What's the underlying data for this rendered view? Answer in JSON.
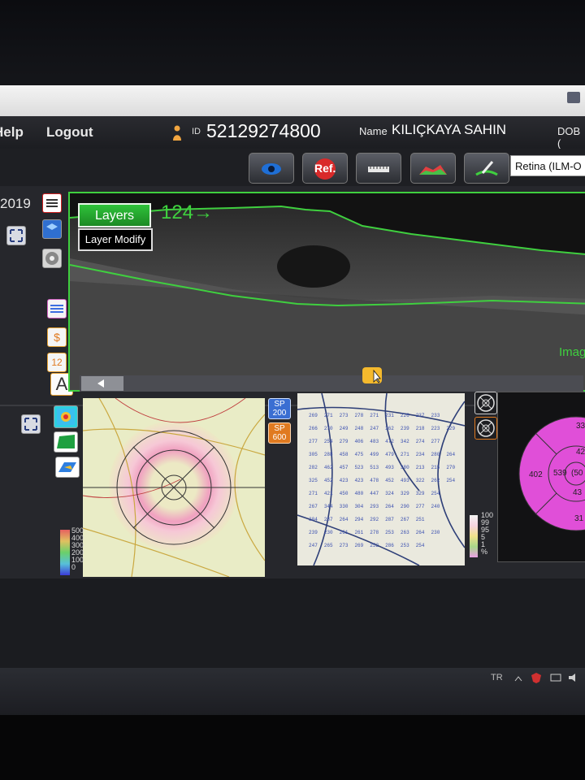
{
  "menu": {
    "help": "Help",
    "logout": "Logout"
  },
  "patient": {
    "id_label": "ID",
    "id_value": "52129274800",
    "name_label": "Name",
    "name_value": "KILIÇKAYA SAHIN",
    "dob_label": "DOB ("
  },
  "toolbar": {
    "ref_label": "Ref.",
    "retina_select": "Retina (ILM-O"
  },
  "sidebar": {
    "date_fragment": "2019",
    "btn_s": "$",
    "btn_12": "12",
    "btn_a": "A"
  },
  "oct": {
    "layers_label": "Layers",
    "layer_modify_label": "Layer Modify",
    "slice_label": "124→",
    "image_label": "Imag"
  },
  "sp_buttons": [
    {
      "label": "SP 200"
    },
    {
      "label": "SP 600"
    }
  ],
  "thickness_legend": {
    "ticks": [
      "500",
      "400",
      "300",
      "200",
      "100",
      "0"
    ]
  },
  "percentile_legend": {
    "ticks": [
      "100",
      "99",
      "95",
      "5",
      "1",
      "%"
    ]
  },
  "etdrs": {
    "values": {
      "top": "33",
      "inner_right": "42",
      "center": "539",
      "inner_left": "(50",
      "outer_left": "402",
      "inner_bottom": "43",
      "bottom": "31"
    }
  },
  "grid_values": [
    [
      "269",
      "271",
      "273",
      "278",
      "271",
      "231",
      "226",
      "237",
      "233"
    ],
    [
      "266",
      "270",
      "249",
      "248",
      "247",
      "262",
      "239",
      "218",
      "223",
      "229"
    ],
    [
      "277",
      "254",
      "279",
      "406",
      "483",
      "472",
      "342",
      "274",
      "277"
    ],
    [
      "305",
      "288",
      "458",
      "475",
      "499",
      "479",
      "271",
      "234",
      "280",
      "264"
    ],
    [
      "282",
      "462",
      "457",
      "523",
      "513",
      "493",
      "380",
      "213",
      "215",
      "270"
    ],
    [
      "325",
      "452",
      "423",
      "423",
      "478",
      "452",
      "493",
      "322",
      "262",
      "254"
    ],
    [
      "271",
      "421",
      "450",
      "480",
      "447",
      "324",
      "329",
      "329",
      "254"
    ],
    [
      "267",
      "344",
      "330",
      "304",
      "293",
      "264",
      "290",
      "277",
      "240"
    ],
    [
      "304",
      "287",
      "264",
      "294",
      "292",
      "287",
      "267",
      "251"
    ],
    [
      "239",
      "230",
      "261",
      "261",
      "278",
      "253",
      "263",
      "264",
      "230"
    ],
    [
      "247",
      "265",
      "273",
      "269",
      "252",
      "286",
      "253",
      "254"
    ]
  ],
  "taskbar": {
    "lang": "TR"
  },
  "colors": {
    "accent_green": "#3fcf3f",
    "etdrs_magenta": "#e04fd8",
    "handle_orange": "#f4b92d"
  }
}
